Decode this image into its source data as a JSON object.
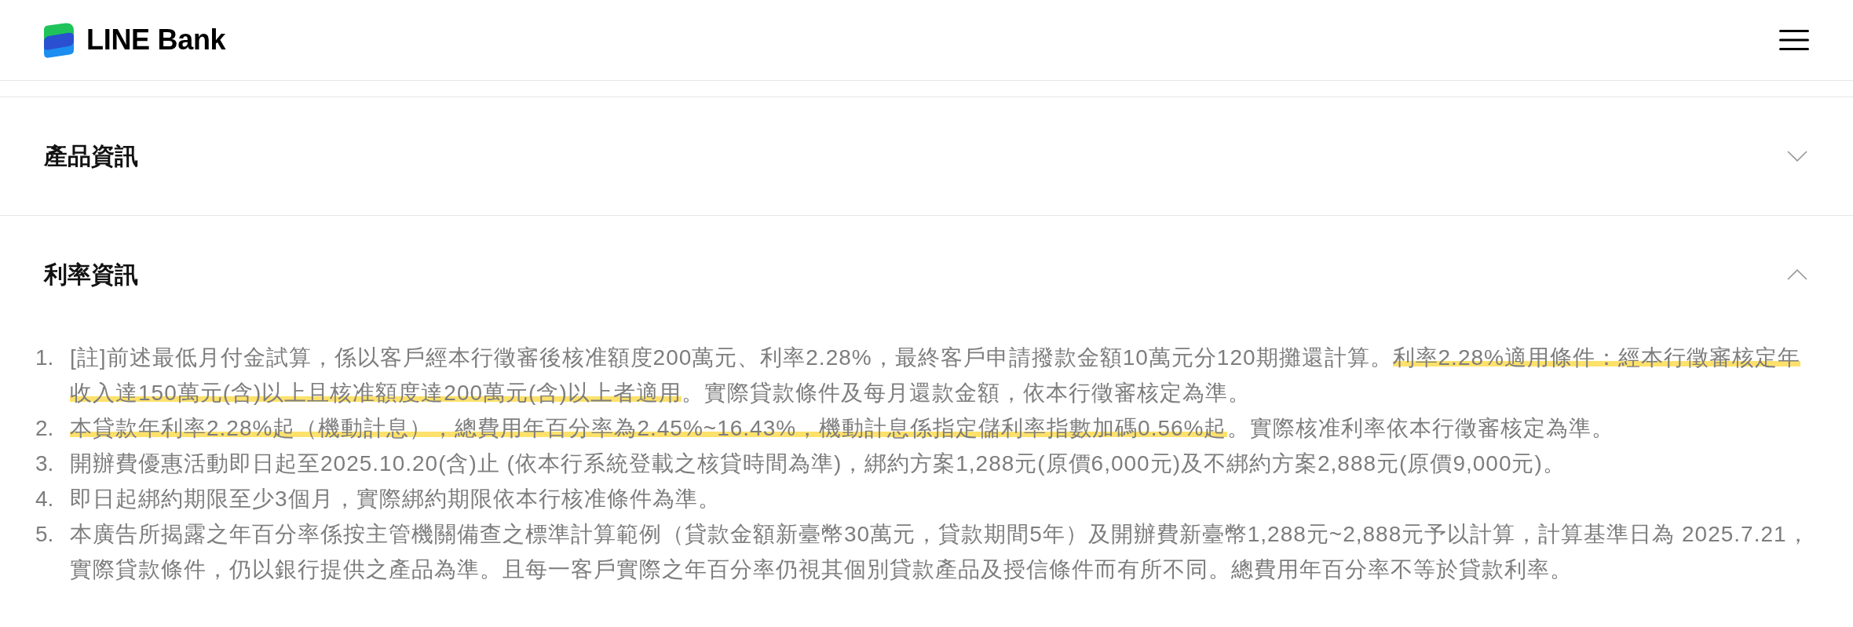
{
  "header": {
    "brand": "LINE Bank"
  },
  "sections": [
    {
      "title": "產品資訊",
      "expanded": false
    },
    {
      "title": "利率資訊",
      "expanded": true,
      "notes": [
        {
          "number": "1.",
          "segments": [
            {
              "text": "[註]前述最低月付金試算，係以客戶經本行徵審後核准額度200萬元、利率2.28%，最終客戶申請撥款金額10萬元分120期攤還計算。",
              "highlighted": false
            },
            {
              "text": "利率2.28%適用條件：經本行徵審核定年收入達150萬元(含)以上且核准額度達200萬元(含)以上者適用",
              "highlighted": true
            },
            {
              "text": "。實際貸款條件及每月還款金額，依本行徵審核定為準。",
              "highlighted": false
            }
          ]
        },
        {
          "number": "2.",
          "segments": [
            {
              "text": "本貸款年利率2.28%起（機動計息），總費用年百分率為2.45%~16.43%，機動計息係指定儲利率指數加碼0.56%起",
              "highlighted": true
            },
            {
              "text": "。實際核准利率依本行徵審核定為準。",
              "highlighted": false
            }
          ]
        },
        {
          "number": "3.",
          "segments": [
            {
              "text": "開辦費優惠活動即日起至2025.10.20(含)止 (依本行系統登載之核貸時間為準)，綁約方案1,288元(原價6,000元)及不綁約方案2,888元(原價9,000元)。",
              "highlighted": false
            }
          ]
        },
        {
          "number": "4.",
          "segments": [
            {
              "text": "即日起綁約期限至少3個月，實際綁約期限依本行核准條件為準。",
              "highlighted": false
            }
          ]
        },
        {
          "number": "5.",
          "segments": [
            {
              "text": "本廣告所揭露之年百分率係按主管機關備查之標準計算範例（貸款金額新臺幣30萬元，貸款期間5年）及開辦費新臺幣1,288元~2,888元予以計算，計算基準日為 2025.7.21，實際貸款條件，仍以銀行提供之產品為準。且每一客戶實際之年百分率仍視其個別貸款產品及授信條件而有所不同。總費用年百分率不等於貸款利率。",
              "highlighted": false
            }
          ]
        }
      ]
    }
  ]
}
